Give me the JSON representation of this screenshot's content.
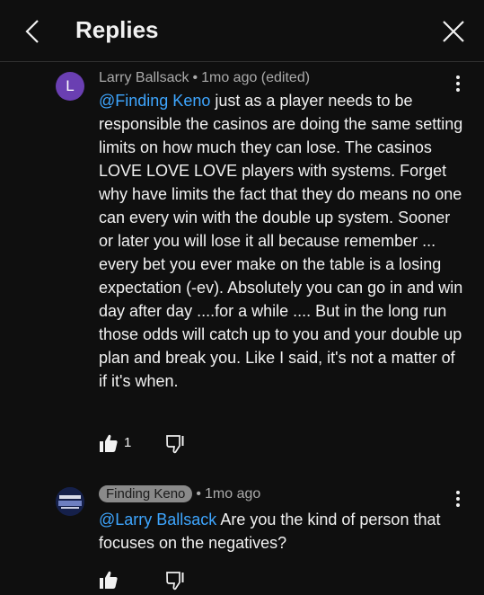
{
  "header": {
    "title": "Replies"
  },
  "comments": [
    {
      "avatar_letter": "L",
      "author": "Larry Ballsack",
      "time": "1mo ago (edited)",
      "mention": "@Finding Keno",
      "text": " just as a player needs to be responsible the casinos are doing the same setting limits on how much they can lose. The casinos LOVE LOVE LOVE players with systems. Forget why have limits the fact that they do means no one can every win with the double up system. Sooner or later you will lose it all because remember ... every bet you ever make on the table is a losing expectation (-ev). Absolutely you can go in and win day after day ....for a while .... But in the long run those odds will catch up to you and your double up plan and break you. Like I said, it's not a matter of if it's when.",
      "likes": "1"
    },
    {
      "author": "Finding Keno",
      "time": "1mo ago",
      "mention": "@Larry Ballsack",
      "text": " Are you the kind of person that focuses on the negatives?"
    }
  ],
  "colors": {
    "background": "#0f0f0f",
    "mention": "#3ea6ff",
    "avatar": "#6a3fb2"
  }
}
